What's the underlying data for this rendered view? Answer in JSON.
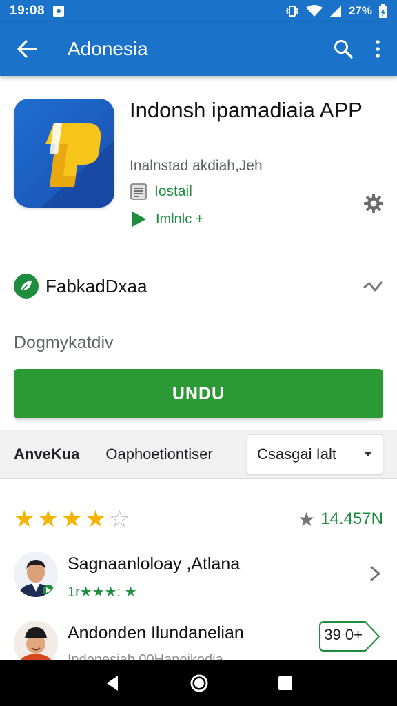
{
  "status_bar": {
    "time": "19:08",
    "battery": "27%"
  },
  "app_bar": {
    "title": "Adonesia"
  },
  "app": {
    "name": "Indonsh ipamadiaia APP",
    "developer": "Inalnstad akdiah,Jeh",
    "install_label": "Iostail",
    "link_label": "Imlnlc +"
  },
  "feature": {
    "label": "FabkadDxaa"
  },
  "description": "Dogmykatdiv",
  "download_button": {
    "label": "UNDU"
  },
  "tabs": {
    "first": "AnveKua",
    "second": "Oaphoetiontiser",
    "dropdown_selected": "Csasgai Ialt"
  },
  "rating": {
    "stars_filled": 4,
    "stars_total": 5,
    "count": "14.457N"
  },
  "reviews": [
    {
      "name": "Sagnaanloloay ,Atlana",
      "sub": "1r★★★: ★"
    },
    {
      "name": "Andonden Ilundanelian",
      "sub": "Indonesiah 00Hanoikodia",
      "tag": "39 0+"
    }
  ],
  "colors": {
    "primary": "#1a73c8",
    "accent_green": "#2c9a34",
    "text_green": "#1e8e3e",
    "star": "#f6b400"
  },
  "icons": {
    "back": "arrow-left-icon",
    "search": "search-icon",
    "more": "more-vert-icon",
    "settings": "gear-icon",
    "install": "document-icon",
    "play": "play-icon",
    "feature": "leaf-icon",
    "trend": "trend-icon",
    "dropdown": "chevron-down-icon"
  }
}
